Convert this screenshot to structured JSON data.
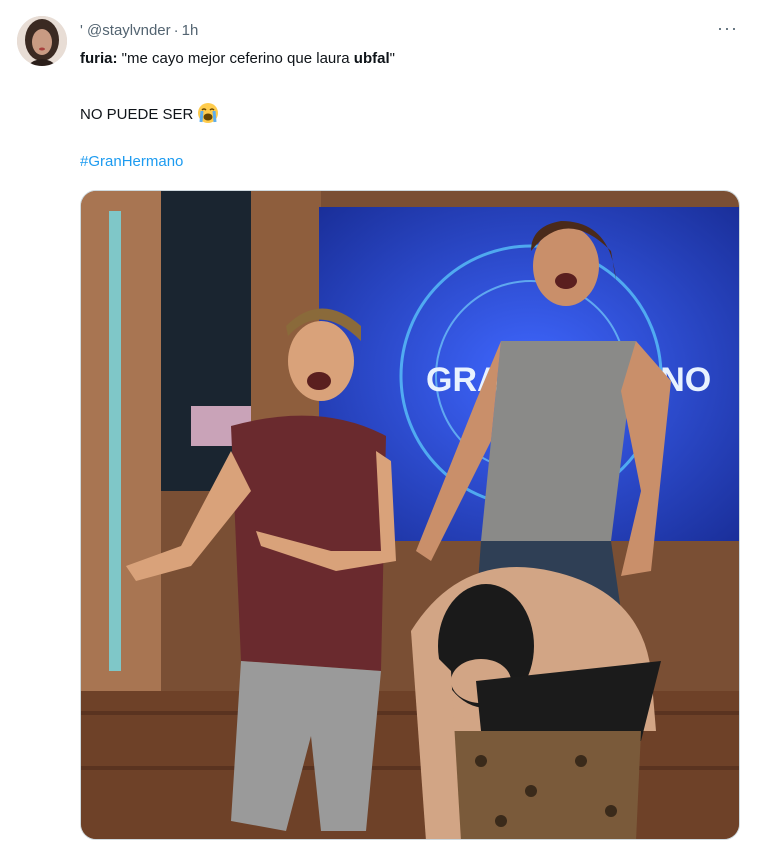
{
  "tweet": {
    "author": {
      "prefix": "'",
      "handle": "@staylvnder",
      "separator": "·",
      "time": "1h",
      "avatar_icon": "profile-photo"
    },
    "more_icon": "more-horizontal-icon",
    "more_label": "···",
    "text": {
      "line1_speaker": "furia:",
      "line1_quote_start": " \"me cayo mejor ceferino que laura ",
      "line1_bold": "ubfal",
      "line1_quote_end": "\"",
      "line2": "NO PUEDE SER",
      "line2_emoji_icon": "loudly-crying-face-emoji",
      "hashtag": "#GranHermano"
    },
    "media": {
      "description_icon": "tv-show-photo",
      "screen_text": "GRAN HERMANO",
      "colors": {
        "screen_blue": "#1f3fb5",
        "wall_wood": "#8a5a3a",
        "floor_wood": "#6e4128"
      }
    }
  },
  "colors": {
    "text": "#0f1419",
    "secondary": "#536471",
    "link": "#1d9bf0"
  }
}
